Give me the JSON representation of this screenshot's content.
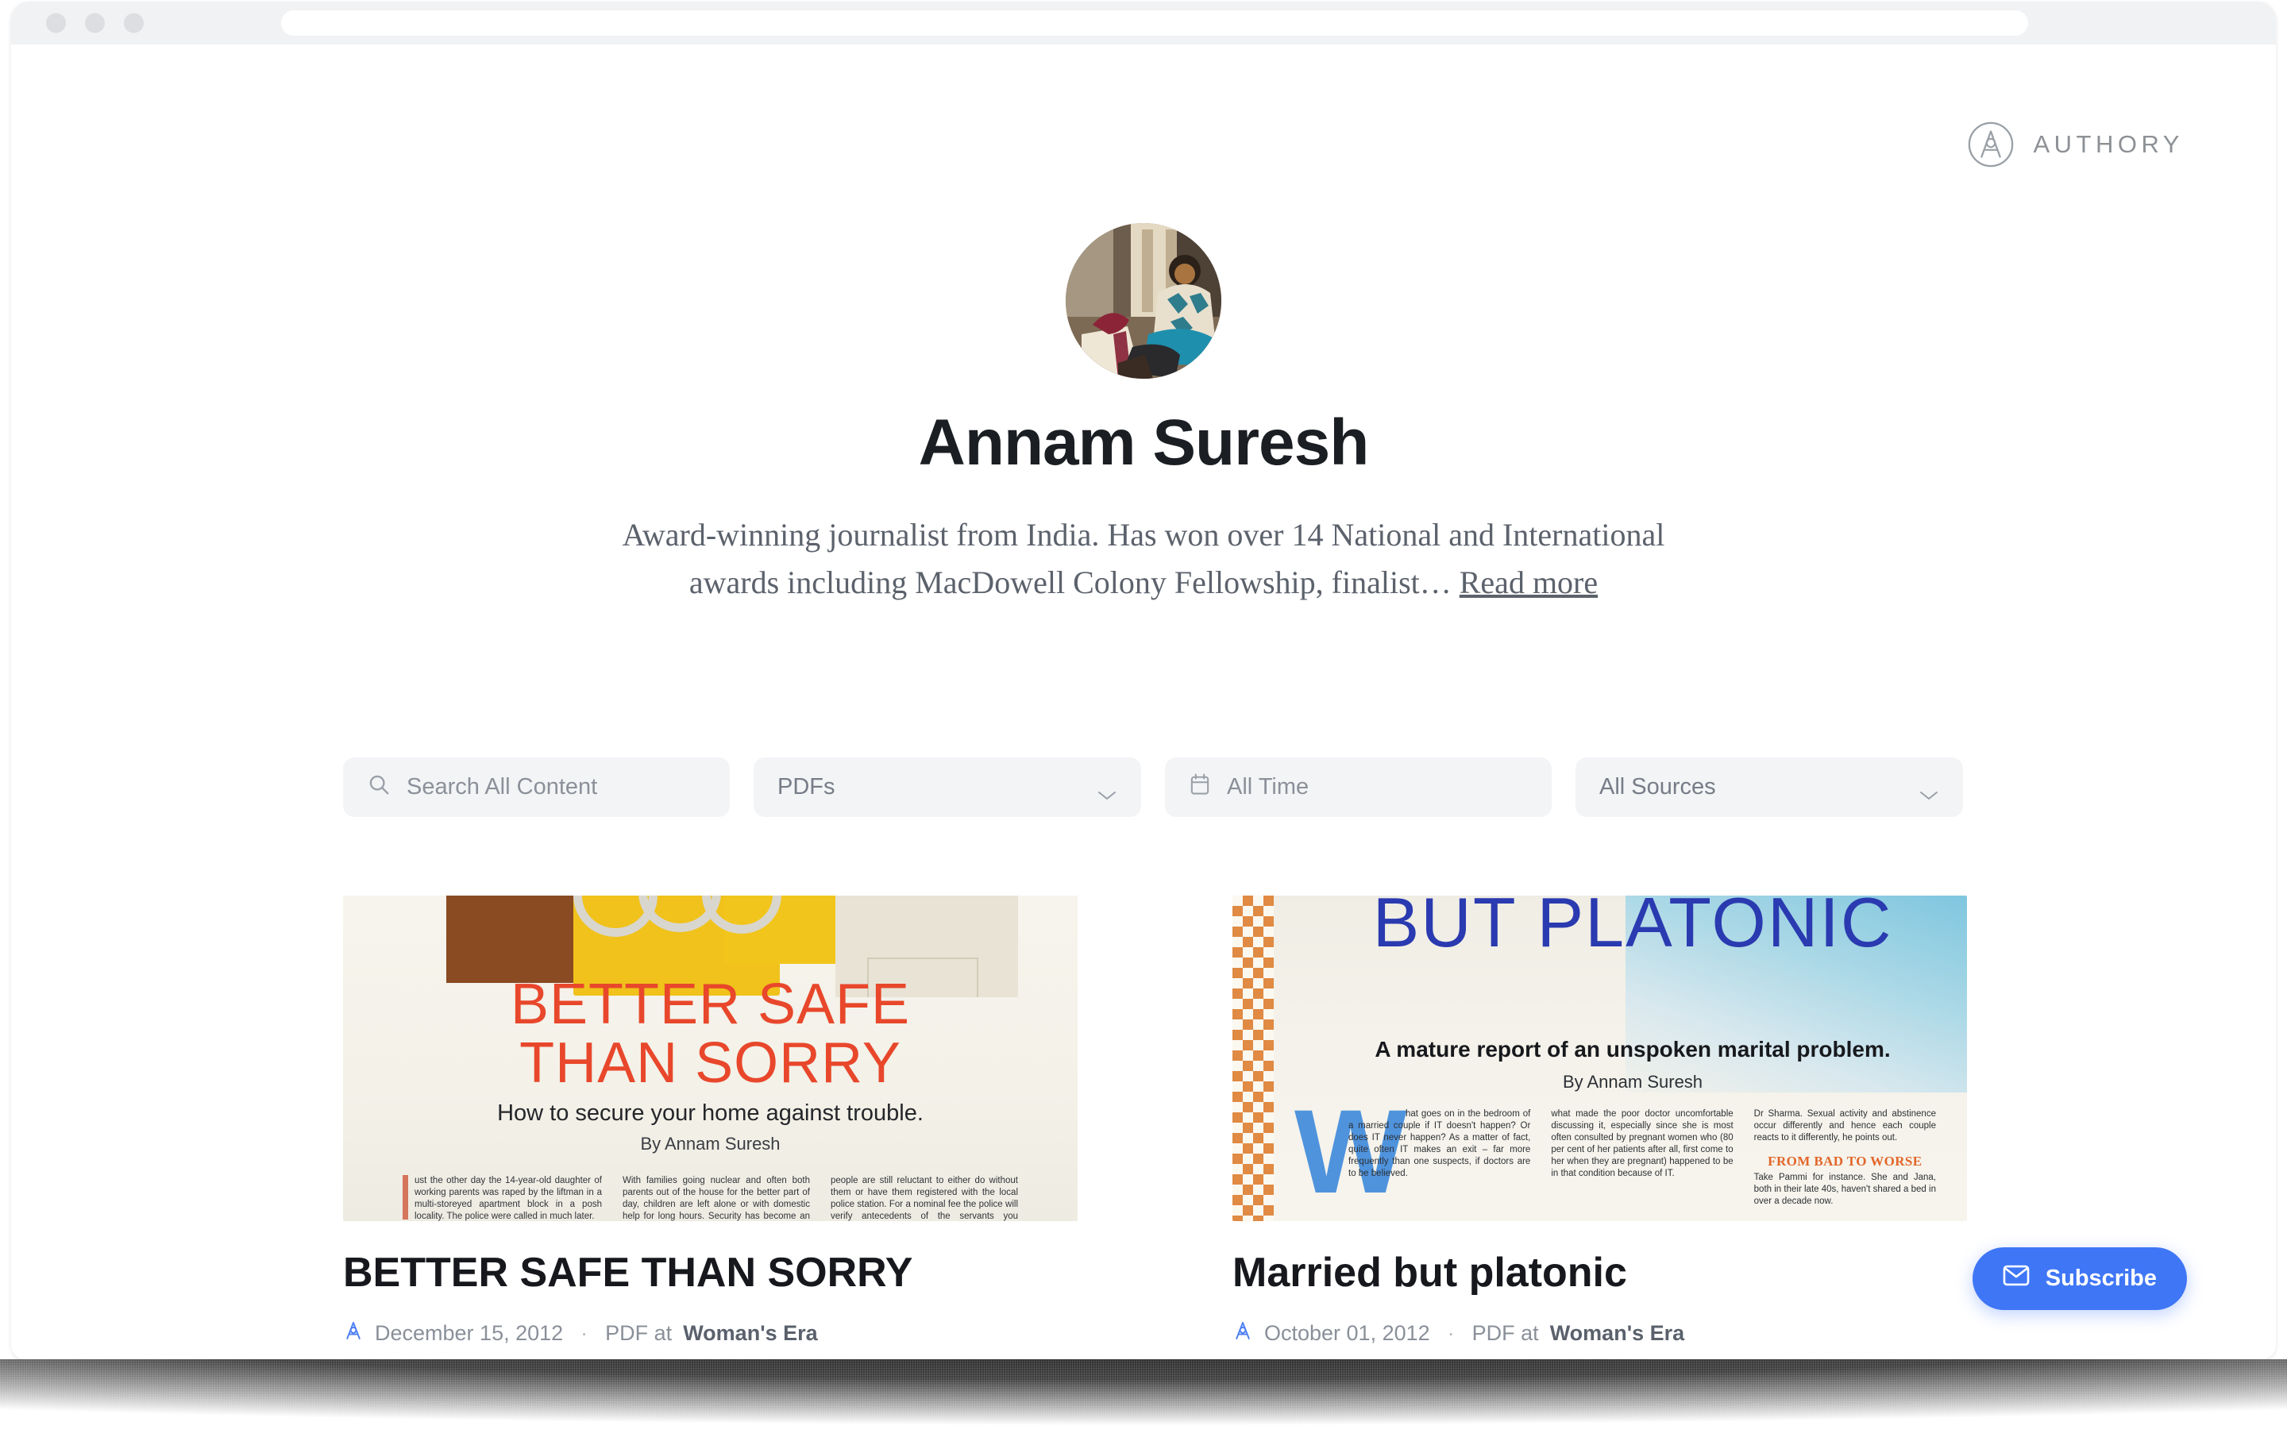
{
  "browser": {
    "traffic_lights": [
      "close",
      "minimize",
      "maximize"
    ],
    "url_value": "",
    "url_placeholder": ""
  },
  "brand": {
    "name": "AUTHORY",
    "logo_icon": "authory-compass-a-icon"
  },
  "profile": {
    "avatar_alt": "Annam Suresh profile photo",
    "name": "Annam Suresh",
    "bio": "Award-winning journalist from India. Has won over 14 National and International awards including MacDowell Colony Fellowship, finalist… ",
    "read_more_label": "Read more"
  },
  "filters": {
    "search": {
      "icon": "search-icon",
      "value": "",
      "placeholder": "Search All Content"
    },
    "kind": {
      "label": "PDFs",
      "icon": "chevron-down-icon"
    },
    "time": {
      "label": "All Time",
      "icon": "calendar-icon"
    },
    "source": {
      "label": "All Sources",
      "icon": "chevron-down-icon"
    }
  },
  "colors": {
    "accent_blue": "#3f76f6",
    "meta_icon_blue": "#4c7ef3",
    "field_bg": "#f3f4f6",
    "title_text": "#16181d",
    "muted_text": "#8a9099"
  },
  "articles": [
    {
      "title": "BETTER SAFE THAN SORRY",
      "icon": "authory-a-icon",
      "date": "December 15, 2012",
      "separator": "·",
      "type_prefix": "PDF at",
      "source": "Woman's Era",
      "thumb": {
        "headline_line1": "BETTER SAFE",
        "headline_line2": "THAN SORRY",
        "subtitle": "How to secure your home against trouble.",
        "byline": "By Annam Suresh",
        "body_columns": [
          "ust the other day the 14-year-old daughter of working parents was raped by the liftman in a multi-storeyed apartment block in a posh locality. The police were called in much later.",
          "With families going nuclear and often both parents out of the house for the better part of day, children are left alone or with domestic help for long hours. Security has become an issue.",
          "people are still reluctant to either do without them or have them registered with the local police station. For a nominal fee the police will verify antecedents of the servants you employ."
        ]
      }
    },
    {
      "title": "Married but platonic",
      "icon": "authory-a-icon",
      "date": "October 01, 2012",
      "separator": "·",
      "type_prefix": "PDF at",
      "source": "Woman's Era",
      "thumb": {
        "headline": "BUT PLATONIC",
        "subtitle": "A mature report of an unspoken marital problem.",
        "byline": "By Annam Suresh",
        "dropcap": "W",
        "body_columns": [
          "hat goes on in the bedroom of a married couple if IT doesn't happen? Or does IT never happen? As a matter of fact, quite often IT makes an exit – far more frequently than one suspects, if doctors are to be believed.",
          "what made the poor doctor uncomfortable discussing it, especially since she is most often consulted by pregnant women who (80 per cent of her patients after all, first come to her when they are pregnant) happened to be in that condition because of IT.",
          "Dr Sharma. Sexual activity and abstinence occur differently and hence each couple reacts to it differently, he points out."
        ],
        "column3_subhead": "FROM BAD TO WORSE",
        "column3_tail": "Take Pammi for instance. She and Jana, both in their late 40s, haven't shared a bed in over a decade now."
      }
    }
  ],
  "subscribe": {
    "label": "Subscribe",
    "icon": "envelope-icon"
  }
}
